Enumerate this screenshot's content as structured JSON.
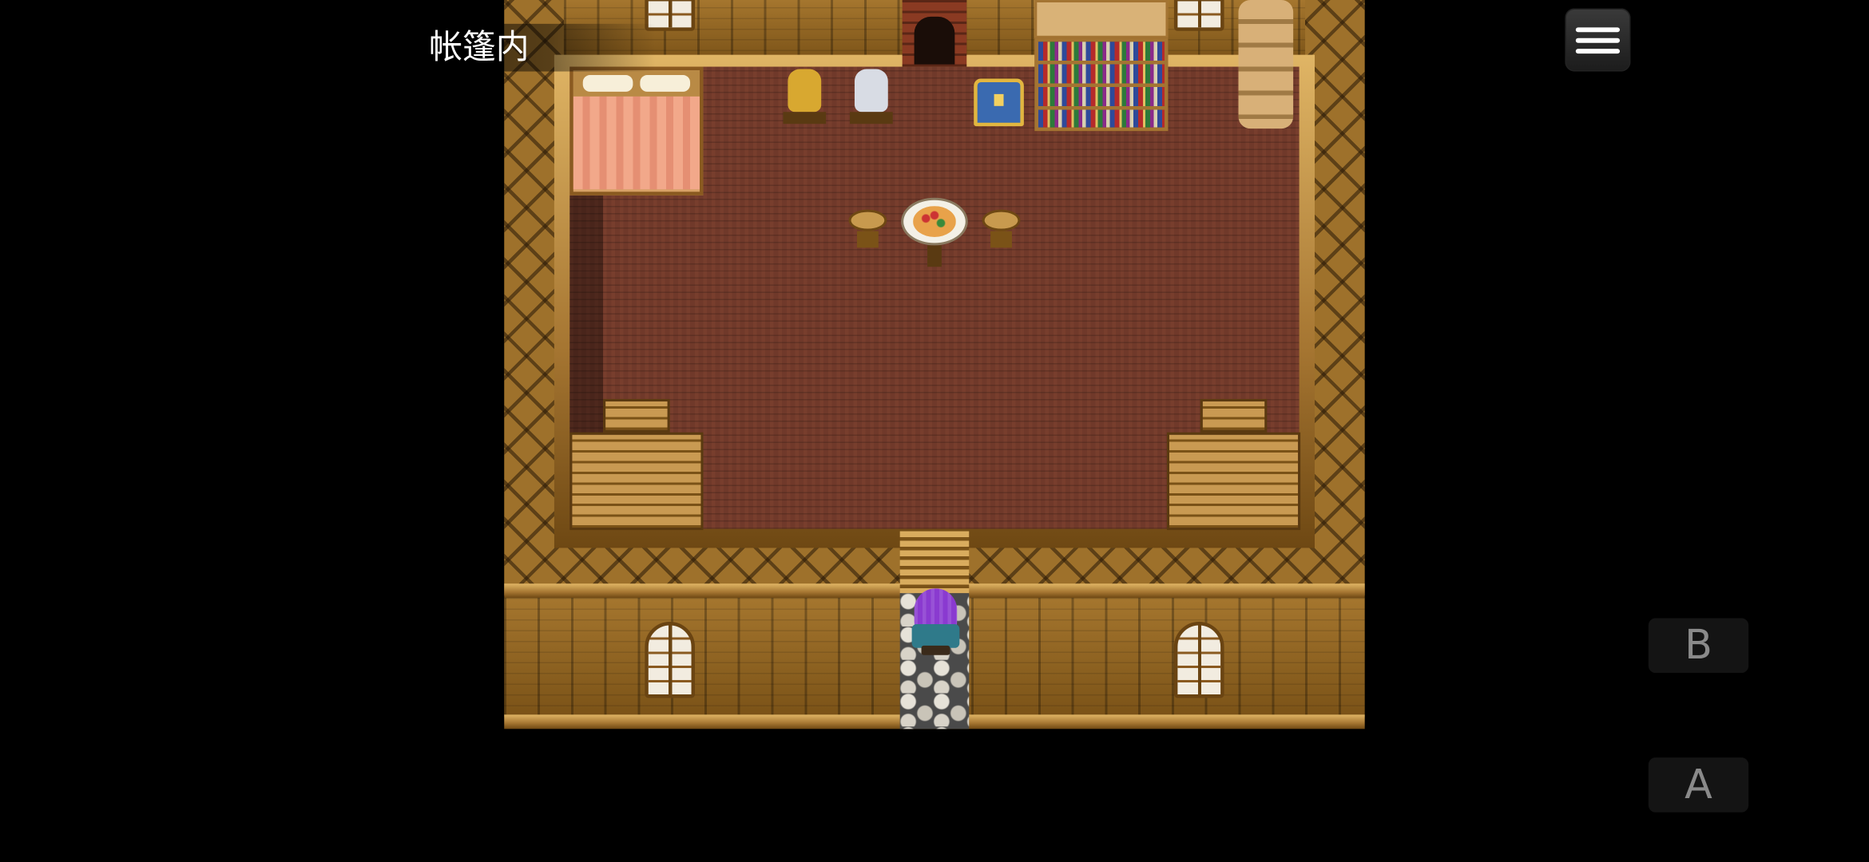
{
  "game": {
    "map_name": "帐篷内"
  },
  "controls": {
    "menu_icon": "hamburger-menu-icon",
    "b_label": "B",
    "a_label": "A"
  },
  "colors": {
    "background": "#000000",
    "hero_hair": "#8a3ad0",
    "floor": "#70392a",
    "wood": "#a5762e"
  }
}
